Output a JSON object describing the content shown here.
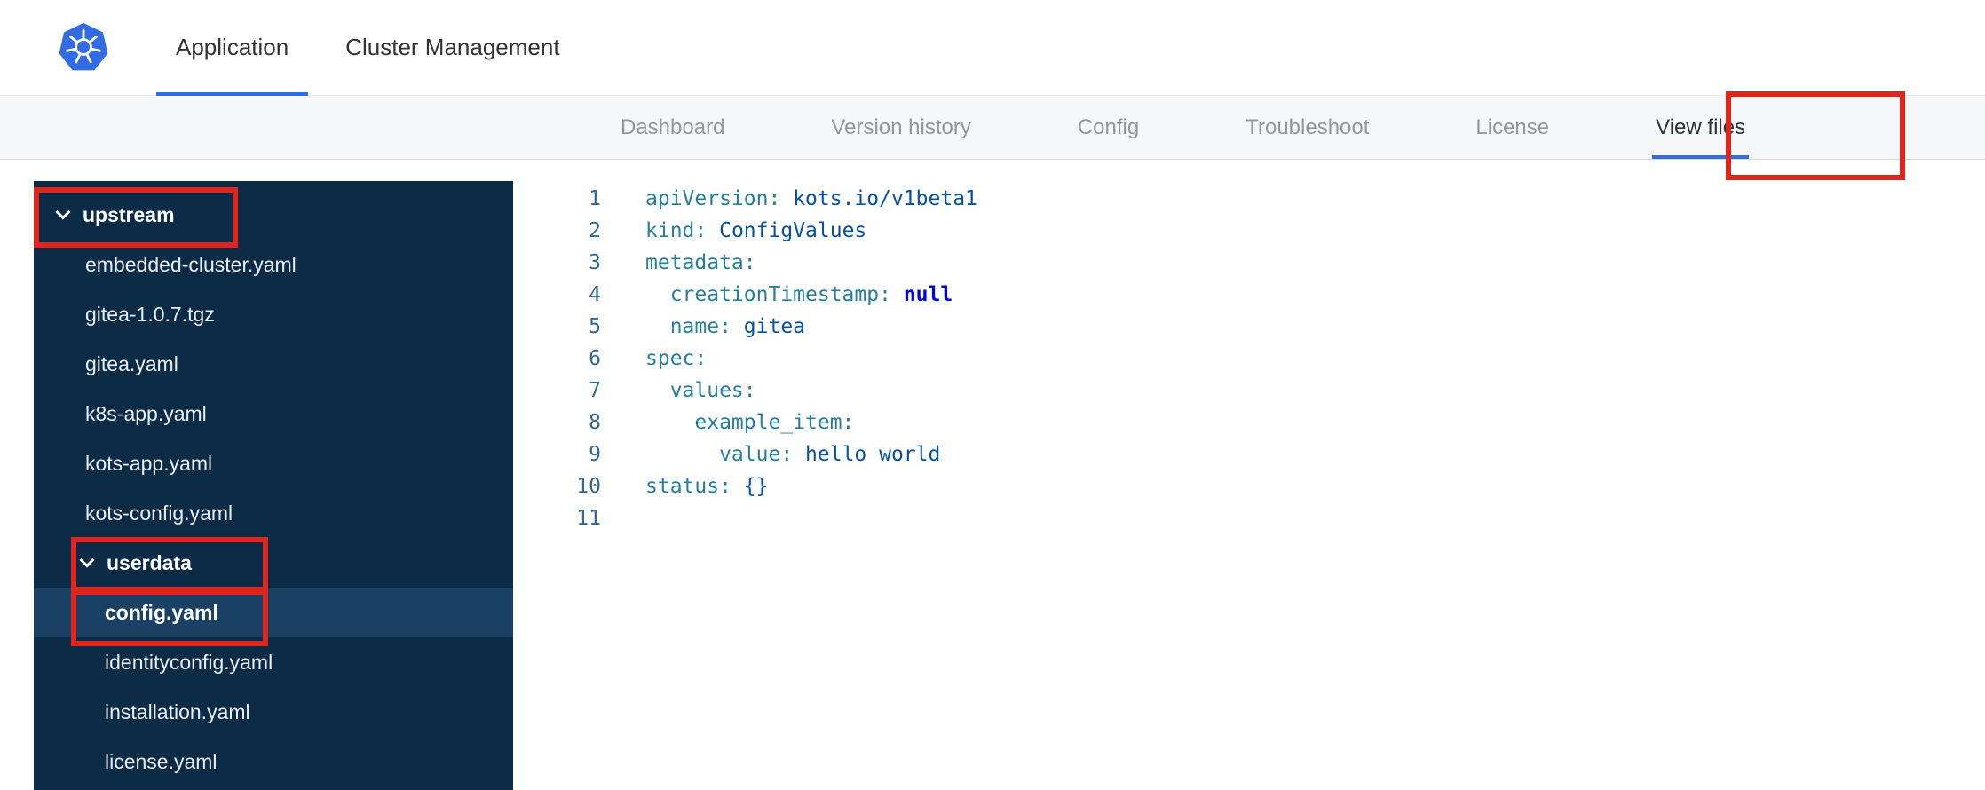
{
  "header": {
    "logo_name": "kubernetes-logo",
    "tabs": [
      {
        "label": "Application",
        "active": true
      },
      {
        "label": "Cluster Management",
        "active": false
      }
    ]
  },
  "subnav": {
    "tabs": [
      {
        "label": "Dashboard",
        "active": false
      },
      {
        "label": "Version history",
        "active": false
      },
      {
        "label": "Config",
        "active": false
      },
      {
        "label": "Troubleshoot",
        "active": false
      },
      {
        "label": "License",
        "active": false
      },
      {
        "label": "View files",
        "active": true
      }
    ]
  },
  "file_tree": {
    "items": [
      {
        "kind": "folder",
        "label": "upstream",
        "depth": 0,
        "expanded": true
      },
      {
        "kind": "file",
        "label": "embedded-cluster.yaml",
        "depth": 1
      },
      {
        "kind": "file",
        "label": "gitea-1.0.7.tgz",
        "depth": 1
      },
      {
        "kind": "file",
        "label": "gitea.yaml",
        "depth": 1
      },
      {
        "kind": "file",
        "label": "k8s-app.yaml",
        "depth": 1
      },
      {
        "kind": "file",
        "label": "kots-app.yaml",
        "depth": 1
      },
      {
        "kind": "file",
        "label": "kots-config.yaml",
        "depth": 1
      },
      {
        "kind": "folder",
        "label": "userdata",
        "depth": 1,
        "expanded": true
      },
      {
        "kind": "file",
        "label": "config.yaml",
        "depth": 2,
        "selected": true
      },
      {
        "kind": "file",
        "label": "identityconfig.yaml",
        "depth": 2
      },
      {
        "kind": "file",
        "label": "installation.yaml",
        "depth": 2
      },
      {
        "kind": "file",
        "label": "license.yaml",
        "depth": 2
      }
    ]
  },
  "editor": {
    "lines": [
      {
        "n": "1",
        "tokens": [
          {
            "c": "key",
            "t": "apiVersion:"
          },
          {
            "c": "plain",
            "t": " "
          },
          {
            "c": "val",
            "t": "kots.io/v1beta1"
          }
        ]
      },
      {
        "n": "2",
        "tokens": [
          {
            "c": "key",
            "t": "kind:"
          },
          {
            "c": "plain",
            "t": " "
          },
          {
            "c": "val",
            "t": "ConfigValues"
          }
        ]
      },
      {
        "n": "3",
        "tokens": [
          {
            "c": "key",
            "t": "metadata:"
          }
        ]
      },
      {
        "n": "4",
        "tokens": [
          {
            "c": "key",
            "t": "  creationTimestamp:"
          },
          {
            "c": "plain",
            "t": " "
          },
          {
            "c": "kw",
            "t": "null"
          }
        ]
      },
      {
        "n": "5",
        "tokens": [
          {
            "c": "key",
            "t": "  name:"
          },
          {
            "c": "plain",
            "t": " "
          },
          {
            "c": "val",
            "t": "gitea"
          }
        ]
      },
      {
        "n": "6",
        "tokens": [
          {
            "c": "key",
            "t": "spec:"
          }
        ]
      },
      {
        "n": "7",
        "tokens": [
          {
            "c": "key",
            "t": "  values:"
          }
        ]
      },
      {
        "n": "8",
        "tokens": [
          {
            "c": "key",
            "t": "    example_item:"
          }
        ]
      },
      {
        "n": "9",
        "tokens": [
          {
            "c": "key",
            "t": "      value:"
          },
          {
            "c": "plain",
            "t": " "
          },
          {
            "c": "val",
            "t": "hello world"
          }
        ]
      },
      {
        "n": "10",
        "tokens": [
          {
            "c": "key",
            "t": "status:"
          },
          {
            "c": "plain",
            "t": " "
          },
          {
            "c": "val",
            "t": "{}"
          }
        ]
      },
      {
        "n": "11",
        "tokens": []
      }
    ]
  },
  "annotations": {
    "color": "#e0251c",
    "boxes": [
      "view-files-tab",
      "upstream-folder",
      "userdata-folder",
      "config-yaml-file"
    ]
  },
  "colors": {
    "accent_blue": "#326de6",
    "sidebar_bg": "#0b2b47",
    "sidebar_selected_bg": "#1a4164",
    "kubernetes_blue": "#326ce5"
  }
}
